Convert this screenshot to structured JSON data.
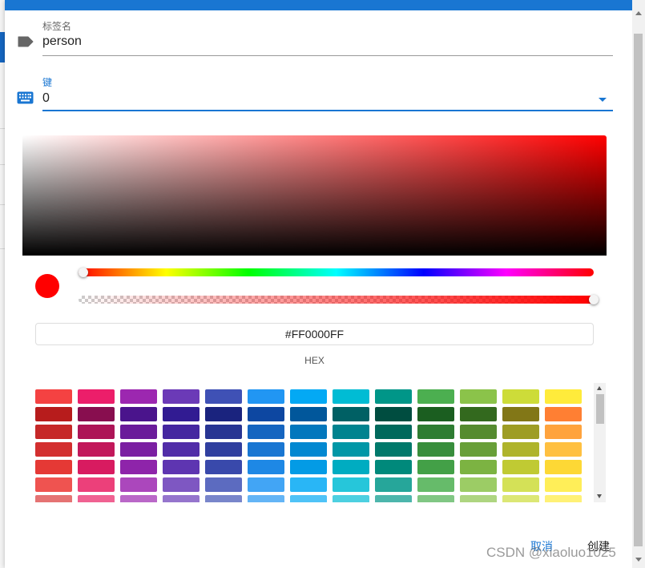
{
  "dialog": {
    "fields": {
      "label_name": {
        "label": "标签名",
        "value": "person",
        "icon": "label-tag-icon"
      },
      "key": {
        "label": "键",
        "value": "0",
        "icon": "keyboard-icon"
      }
    },
    "color_picker": {
      "current_color": "#FF0000",
      "hue_degrees": 0,
      "alpha": 1,
      "hex_value": "#FF0000FF",
      "hex_label": "HEX",
      "swatch_rows": [
        [
          "#F44242",
          "#EC1E6A",
          "#9C27B0",
          "#6B3AB7",
          "#3F51B5",
          "#2196F3",
          "#03A9F4",
          "#00BCD4",
          "#009688",
          "#4CAF50",
          "#8BC34A",
          "#CDDC39",
          "#FFEB3B"
        ],
        [
          "#B71C1C",
          "#880E4F",
          "#4A148C",
          "#311B92",
          "#1A237E",
          "#0D47A1",
          "#01579B",
          "#006064",
          "#004D40",
          "#1B5E20",
          "#33691E",
          "#827717",
          "#FF7F33"
        ],
        [
          "#C62828",
          "#AD1457",
          "#6A1B9A",
          "#4527A0",
          "#283593",
          "#1565C0",
          "#0277BD",
          "#00838F",
          "#00695C",
          "#2E7D32",
          "#558B2F",
          "#9E9D24",
          "#FFA33D"
        ],
        [
          "#D32F2F",
          "#C2185B",
          "#7B1FA2",
          "#512DA8",
          "#303F9F",
          "#1976D2",
          "#0288D1",
          "#0097A7",
          "#00796B",
          "#388E3C",
          "#689F38",
          "#AFB42B",
          "#FFC040"
        ],
        [
          "#E53935",
          "#D81B60",
          "#8E24AA",
          "#5E35B1",
          "#3949AB",
          "#1E88E5",
          "#039BE5",
          "#00ACC1",
          "#00897B",
          "#43A047",
          "#7CB342",
          "#C0CA33",
          "#FDD835"
        ],
        [
          "#EF5350",
          "#EC407A",
          "#AB47BC",
          "#7E57C2",
          "#5C6BC0",
          "#42A5F5",
          "#29B6F6",
          "#26C6DA",
          "#26A69A",
          "#66BB6A",
          "#9CCC65",
          "#D4E157",
          "#FFEE58"
        ],
        [
          "#E57373",
          "#F06292",
          "#BA68C8",
          "#9575CD",
          "#7986CB",
          "#64B5F6",
          "#4FC3F7",
          "#4DD0E1",
          "#4DB6AC",
          "#81C784",
          "#AED581",
          "#DCE775",
          "#FFF176"
        ]
      ]
    },
    "buttons": {
      "cancel": "取消",
      "create": "创建"
    }
  },
  "watermark": "CSDN @xiaoluo1025",
  "colors": {
    "accent": "#1976d2",
    "topbar": "#1976d2"
  }
}
